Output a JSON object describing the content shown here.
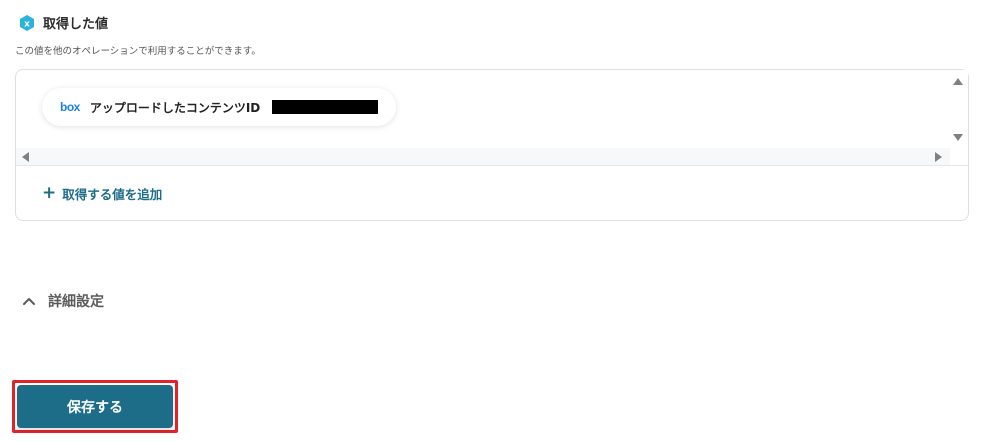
{
  "section": {
    "title": "取得した値",
    "description": "この値を他のオペレーションで利用することができます。",
    "icon": "yoom-x-icon",
    "icon_color": "#2bb3d9"
  },
  "value_chip": {
    "service_icon_text": "box",
    "label": "アップロードしたコンテンツID"
  },
  "add_value": {
    "icon": "plus-icon",
    "label": "取得する値を追加"
  },
  "details": {
    "icon": "chevron-up-icon",
    "label": "詳細設定"
  },
  "save": {
    "label": "保存する",
    "color": "#1d6c88",
    "highlight_color": "#e0242b"
  }
}
